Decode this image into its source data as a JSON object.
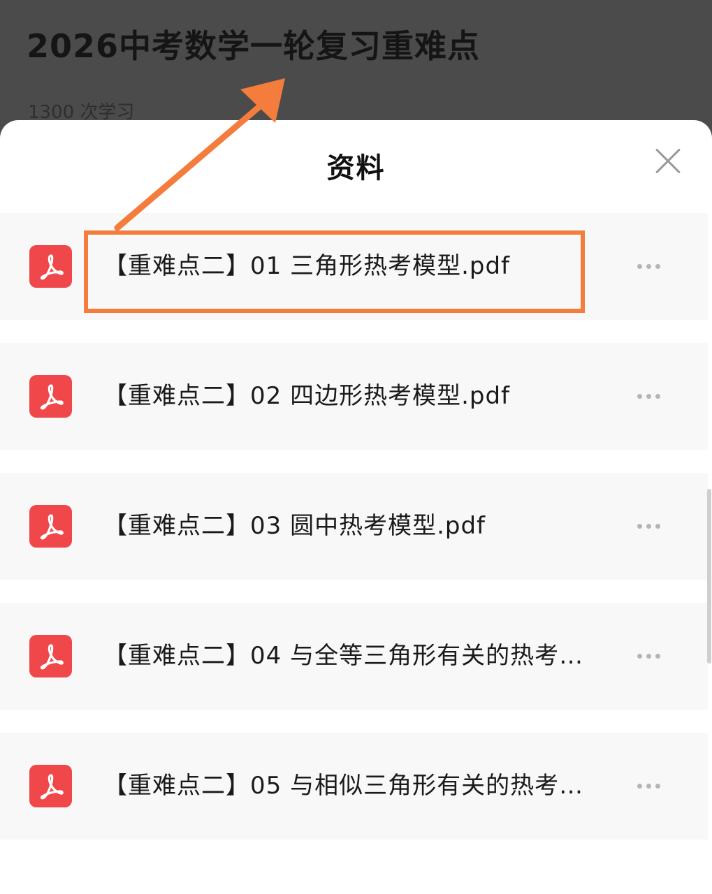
{
  "background_page": {
    "course_title": "2026中考数学一轮复习重难点",
    "learn_count": "1300 次学习"
  },
  "sheet": {
    "title": "资料",
    "close_icon": "close-icon"
  },
  "files": [
    {
      "name": "【重难点二】01 三角形热考模型.pdf",
      "icon": "pdf-icon",
      "highlighted": true
    },
    {
      "name": "【重难点二】02 四边形热考模型.pdf",
      "icon": "pdf-icon",
      "highlighted": false
    },
    {
      "name": "【重难点二】03 圆中热考模型.pdf",
      "icon": "pdf-icon",
      "highlighted": false
    },
    {
      "name": "【重难点二】04 与全等三角形有关的热考…",
      "icon": "pdf-icon",
      "highlighted": false
    },
    {
      "name": "【重难点二】05 与相似三角形有关的热考…",
      "icon": "pdf-icon",
      "highlighted": false
    }
  ],
  "colors": {
    "accent_orange": "#f47c3c",
    "pdf_red": "#f0474b",
    "overlay_gray": "#4b4b4b"
  }
}
